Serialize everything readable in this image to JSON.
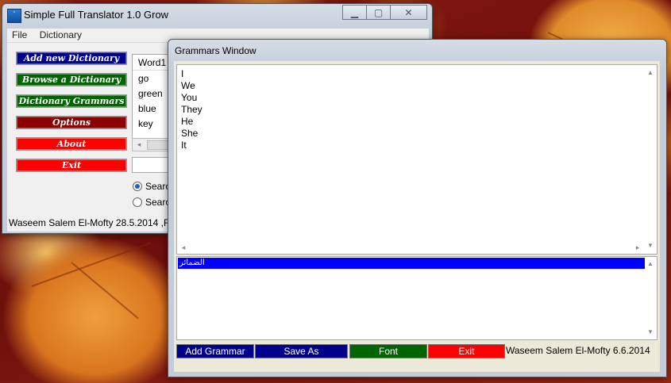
{
  "colors": {
    "button_navy": "#00008b",
    "button_green": "#006400",
    "button_maroon": "#8b0000",
    "button_red": "#ff0000",
    "selection_blue": "#0000ff"
  },
  "main_window": {
    "title": "Simple Full Translator 1.0 Grow",
    "menu": [
      "File",
      "Dictionary"
    ],
    "buttons": {
      "add_dictionary": "Add new Dictionary",
      "browse_dictionary": "Browse a Dictionary",
      "dictionary_grammars": "Dictionary Grammars",
      "options": "Options",
      "about": "About",
      "exit": "Exit"
    },
    "list": {
      "header": "Word1",
      "items": [
        "go",
        "green",
        "blue",
        "key"
      ]
    },
    "radio": {
      "option1": "Searc",
      "option2": "Searc",
      "selected": "option1"
    },
    "status": "Waseem Salem El-Mofty 28.5.2014 ,F"
  },
  "grammars_window": {
    "title": "Grammars Window",
    "text_lines": [
      "I",
      "We",
      "You",
      "They",
      "He",
      "She",
      "It"
    ],
    "list_items": [
      "الضمائر"
    ],
    "buttons": {
      "add_grammar": "Add Grammar",
      "save_as": "Save As",
      "font": "Font",
      "exit": "Exit"
    },
    "status": "Waseem Salem El-Mofty 6.6.2014"
  }
}
